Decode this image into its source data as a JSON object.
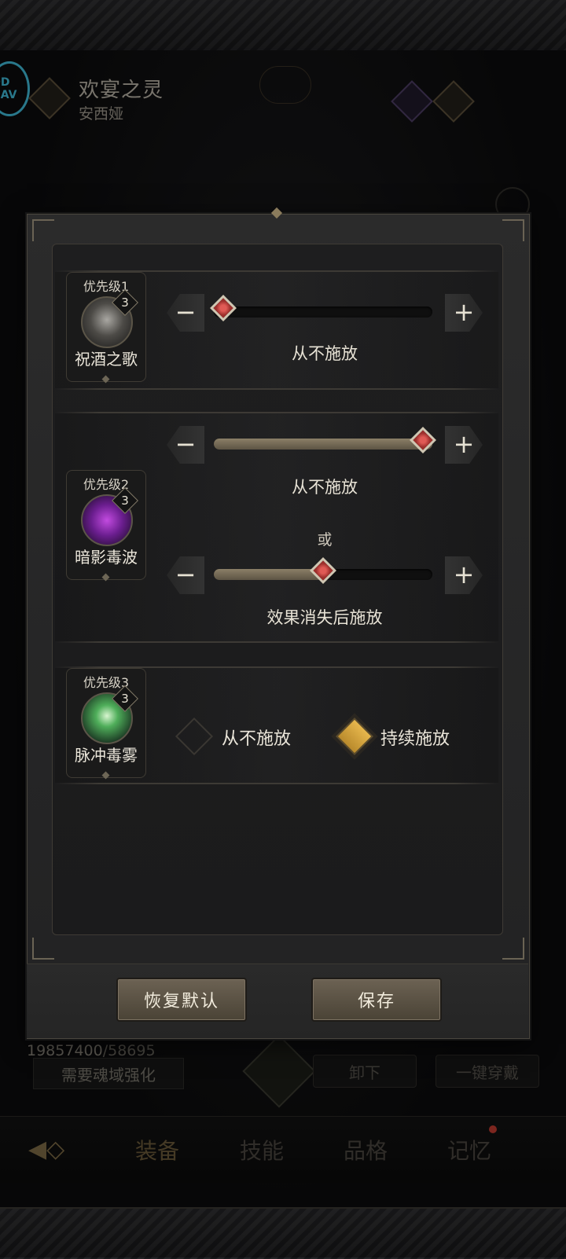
{
  "header": {
    "logo_text": "QD\nNAV",
    "title": "欢宴之灵",
    "subtitle": "安西娅"
  },
  "background": {
    "soul_current": "19857400",
    "soul_max": "/58695",
    "soul_button": "需要魂域强化",
    "unequip_button": "卸下",
    "equip_all_button": "一键穿戴",
    "tabs": [
      "装备",
      "技能",
      "品格",
      "记忆"
    ],
    "active_tab": "装备",
    "notification_color": "#c03b30"
  },
  "dialog": {
    "skills": [
      {
        "priority": "优先级1",
        "name": "祝酒之歌",
        "level": "3",
        "icon": "goblet-icon",
        "sliders": [
          {
            "value": 0,
            "caption": "从不施放"
          }
        ]
      },
      {
        "priority": "优先级2",
        "name": "暗影毒波",
        "level": "3",
        "icon": "shadow-poison-icon",
        "sliders": [
          {
            "value": 1.0,
            "caption": "从不施放"
          },
          {
            "value": 0.5,
            "caption": "效果消失后施放"
          }
        ],
        "or_text": "或"
      },
      {
        "priority": "优先级3",
        "name": "脉冲毒雾",
        "level": "3",
        "icon": "pulse-fog-icon",
        "options": [
          {
            "label": "从不施放",
            "checked": false
          },
          {
            "label": "持续施放",
            "checked": true
          }
        ]
      }
    ],
    "buttons": {
      "reset": "恢复默认",
      "save": "保存"
    },
    "minus": "−",
    "plus": "+"
  },
  "colors": {
    "handle": "#e05a55",
    "checked": "#e7b74d"
  }
}
